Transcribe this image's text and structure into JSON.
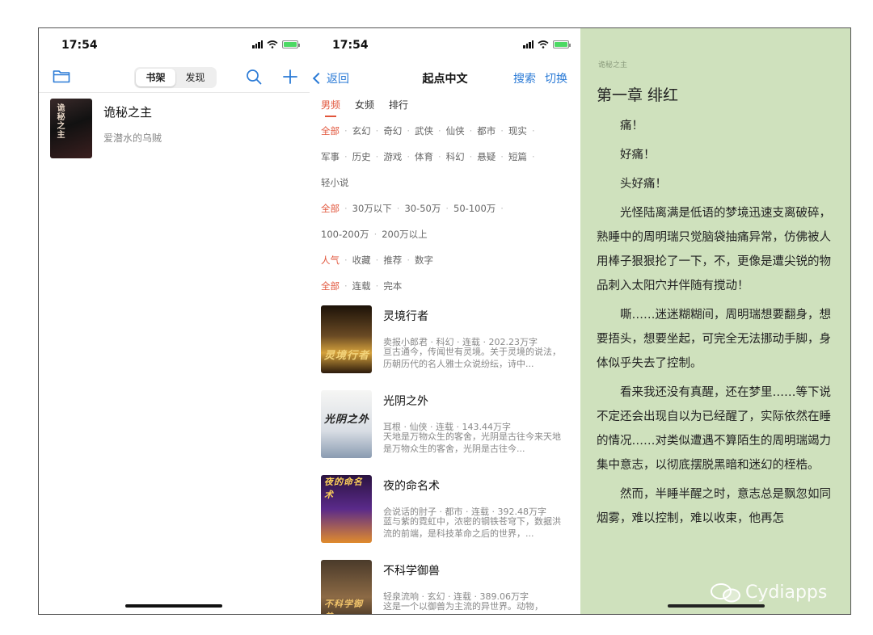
{
  "colors": {
    "accent_blue": "#2a7ad6",
    "accent_red": "#e1553b",
    "reader_bg": "#cfe1bd"
  },
  "bookshelf_panel": {
    "status_time": "17:54",
    "segments": [
      {
        "label": "书架",
        "selected": true
      },
      {
        "label": "发现",
        "selected": false
      }
    ],
    "icons": [
      "folder-icon",
      "search-icon",
      "plus-icon"
    ],
    "shelf": [
      {
        "cover_text": "诡秘之主",
        "title": "诡秘之主",
        "author": "爱潜水的乌贼"
      }
    ]
  },
  "discover_panel": {
    "status_time": "17:54",
    "back_label": "返回",
    "title": "起点中文",
    "search_label": "搜索",
    "switch_label": "切换",
    "tabs": [
      {
        "label": "男频",
        "selected": true
      },
      {
        "label": "女频",
        "selected": false
      },
      {
        "label": "排行",
        "selected": false
      }
    ],
    "genre_rows": [
      [
        "全部",
        "玄幻",
        "奇幻",
        "武侠",
        "仙侠",
        "都市",
        "现实"
      ],
      [
        "军事",
        "历史",
        "游戏",
        "体育",
        "科幻",
        "悬疑",
        "短篇"
      ],
      [
        "轻小说"
      ]
    ],
    "wordcount_rows": [
      [
        "全部",
        "30万以下",
        "30-50万",
        "50-100万"
      ],
      [
        "100-200万",
        "200万以上"
      ]
    ],
    "sort_row": [
      "人气",
      "收藏",
      "推荐",
      "数字"
    ],
    "status_row": [
      "全部",
      "连载",
      "完本"
    ],
    "books": [
      {
        "title": "灵境行者",
        "cover_text": "灵境行者",
        "meta": "卖报小郎君 · 科幻 · 连载 · 202.23万字",
        "desc": "亘古通今，传闻世有灵境。关于灵境的说法，历朝历代的名人雅士众说纷纭，诗中..."
      },
      {
        "title": "光阴之外",
        "cover_text": "光阴之外",
        "meta": "耳根 · 仙侠 · 连载 · 143.44万字",
        "desc": "天地是万物众生的客舍，光阴是古往今来天地是万物众生的客舍，光阴是古往今..."
      },
      {
        "title": "夜的命名术",
        "cover_text": "夜的命名术",
        "meta": "会说话的肘子 · 都市 · 连载 · 392.48万字",
        "desc": "蓝与紫的霓虹中，浓密的钢铁苍穹下，数据洪流的前端，是科技革命之后的世界，..."
      },
      {
        "title": "不科学御兽",
        "cover_text": "不科学御兽",
        "meta": "轻泉流响 · 玄幻 · 连载 · 389.06万字",
        "desc": "这是一个以御兽为主流的异世界。动物，"
      }
    ]
  },
  "reader_panel": {
    "book_name": "诡秘之主",
    "chapter_title": "第一章 绯红",
    "paragraphs": [
      "痛！",
      "好痛！",
      "头好痛！",
      "光怪陆离满是低语的梦境迅速支离破碎，熟睡中的周明瑞只觉脑袋抽痛异常，仿佛被人用棒子狠狠抡了一下，不，更像是遭尖锐的物品刺入太阳穴并伴随有搅动！",
      "嘶……迷迷糊糊间，周明瑞想要翻身，想要捂头，想要坐起，可完全无法挪动手脚，身体似乎失去了控制。",
      "看来我还没有真醒，还在梦里……等下说不定还会出现自以为已经醒了，实际依然在睡的情况……对类似遭遇不算陌生的周明瑞竭力集中意志，以彻底摆脱黑暗和迷幻的桎梏。",
      "然而，半睡半醒之时，意志总是飘忽如同烟雾，难以控制，难以收束，他再怎"
    ],
    "watermark": "Cydiapps"
  }
}
